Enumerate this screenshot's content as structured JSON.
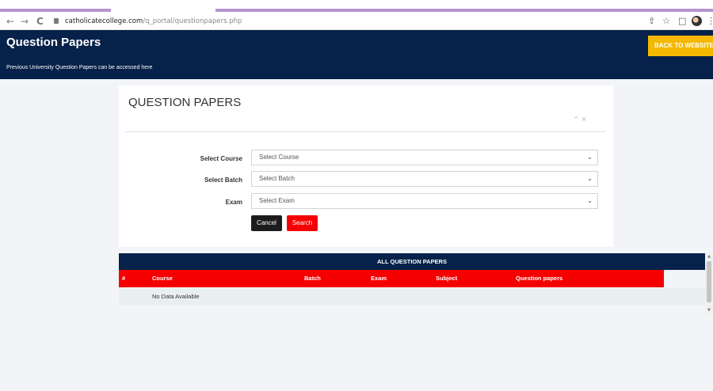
{
  "browser": {
    "url_host": "catholicatecollege.com",
    "url_path": "/q_portal/questionpapers.php",
    "back_glyph": "←",
    "forward_glyph": "→",
    "reload_glyph": "C",
    "share_glyph": "⇪",
    "star_glyph": "☆",
    "sidepanel_glyph": "□",
    "menu_glyph": "⋮"
  },
  "header": {
    "title": "Question Papers",
    "subtitle": "Previous University Question Papers can be accessed here",
    "back_button": "BACK TO WEBSITE",
    "bg_color": "#06224a",
    "button_color": "#f5b800"
  },
  "card": {
    "title": "QUESTION PAPERS",
    "collapse_glyph": "^",
    "close_glyph": "×"
  },
  "form": {
    "fields": [
      {
        "label": "Select Course",
        "value": "Select Course"
      },
      {
        "label": "Select Batch",
        "value": "Select Batch"
      },
      {
        "label": "Exam",
        "value": "Select Exam"
      }
    ],
    "chevron_glyph": "⌄",
    "cancel_label": "Cancel",
    "search_label": "Search",
    "search_color": "#f40000"
  },
  "table": {
    "caption": "ALL QUESTION PAPERS",
    "columns": [
      "#",
      "Course",
      "Batch",
      "Exam",
      "Subject",
      "Question papers"
    ],
    "empty_text": "No Data Available",
    "header_color": "#f40000"
  },
  "scrollbar": {
    "up_glyph": "▲",
    "down_glyph": "▼"
  }
}
